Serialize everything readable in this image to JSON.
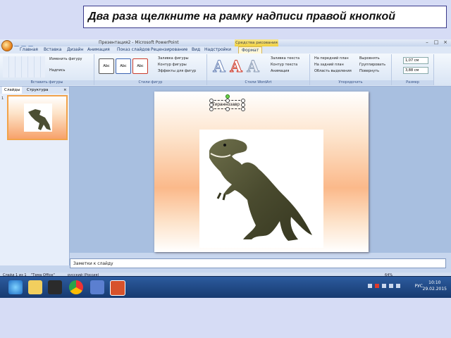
{
  "instruction": "Два раза щелкните на рамку надписи правой кнопкой",
  "window": {
    "title": "Презентация2 - Microsoft PowerPoint",
    "context_title": "Средства рисования",
    "controls": [
      "–",
      "□",
      "×"
    ]
  },
  "tabs": [
    {
      "label": "Главная",
      "active": false
    },
    {
      "label": "Вставка",
      "active": false
    },
    {
      "label": "Дизайн",
      "active": false
    },
    {
      "label": "Анимация",
      "active": false
    },
    {
      "label": "Показ слайдов",
      "active": false
    },
    {
      "label": "Рецензирование",
      "active": false
    },
    {
      "label": "Вид",
      "active": false
    },
    {
      "label": "Надстройки",
      "active": false
    },
    {
      "label": "Формат",
      "active": true
    }
  ],
  "ribbon": {
    "groups": [
      {
        "label": "Вставить фигуры"
      },
      {
        "label": "Стили фигур"
      },
      {
        "label": "Стили WordArt"
      },
      {
        "label": "Упорядочить"
      },
      {
        "label": "Размер"
      }
    ],
    "insert_shapes": {
      "change_shape": "Изменить фигуру",
      "textbox": "Надпись"
    },
    "shape_styles": {
      "sample": "Abc",
      "fill": "Заливка фигуры",
      "outline": "Контур фигуры",
      "effects": "Эффекты для фигур"
    },
    "wordart": {
      "text_fill": "Заливка текста",
      "text_outline": "Контур текста",
      "text_effects": "Анимация"
    },
    "arrange": {
      "bring_front": "На передний план",
      "send_back": "На задний план",
      "selection_pane": "Область выделения",
      "align": "Выровнять",
      "group": "Группировать",
      "rotate": "Повернуть"
    },
    "size": {
      "height": "1,07 см",
      "width": "3,88 см"
    }
  },
  "slides_panel": {
    "tabs": [
      "Слайды",
      "Структура"
    ],
    "close": "×",
    "thumbnail_number": "1"
  },
  "slide": {
    "textbox_text": "Тираннозавр"
  },
  "notes": {
    "placeholder": "Заметки к слайду"
  },
  "statusbar": {
    "slide_info": "Слайд 1 из 1",
    "theme": "\"Тема Office\"",
    "language": "русский (Россия)",
    "zoom": "64%"
  },
  "taskbar": {
    "language": "РУС",
    "time": "10:10",
    "date": "29.02.2015"
  },
  "colors": {
    "context_tab": "#f0cf3e",
    "taskbar": "#1f4784",
    "selection": "#f2a34a"
  }
}
